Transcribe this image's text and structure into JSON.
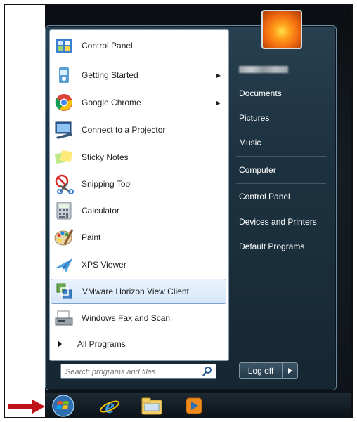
{
  "start_menu": {
    "programs": [
      {
        "label": "Control Panel",
        "icon": "control-panel-icon",
        "has_submenu": false
      },
      {
        "label": "Getting Started",
        "icon": "getting-started-icon",
        "has_submenu": true
      },
      {
        "label": "Google Chrome",
        "icon": "chrome-icon",
        "has_submenu": true
      },
      {
        "label": "Connect to a Projector",
        "icon": "projector-icon",
        "has_submenu": false
      },
      {
        "label": "Sticky Notes",
        "icon": "sticky-notes-icon",
        "has_submenu": false
      },
      {
        "label": "Snipping Tool",
        "icon": "snipping-tool-icon",
        "has_submenu": false
      },
      {
        "label": "Calculator",
        "icon": "calculator-icon",
        "has_submenu": false
      },
      {
        "label": "Paint",
        "icon": "paint-icon",
        "has_submenu": false
      },
      {
        "label": "XPS Viewer",
        "icon": "xps-viewer-icon",
        "has_submenu": false
      },
      {
        "label": "VMware Horizon View Client",
        "icon": "vmware-icon",
        "has_submenu": false,
        "selected": true
      },
      {
        "label": "Windows Fax and Scan",
        "icon": "fax-scan-icon",
        "has_submenu": false
      }
    ],
    "all_programs_label": "All Programs",
    "search_placeholder": "Search programs and files",
    "right_links": {
      "documents": "Documents",
      "pictures": "Pictures",
      "music": "Music",
      "computer": "Computer",
      "control_panel": "Control Panel",
      "devices_printers": "Devices and Printers",
      "default_programs": "Default Programs"
    },
    "logoff_label": "Log off"
  },
  "taskbar": {
    "icons": [
      "windows-start-orb-icon",
      "internet-explorer-icon",
      "file-explorer-icon",
      "media-player-icon"
    ]
  },
  "colors": {
    "selection_border": "#7da2ce",
    "menu_background": "#1d3241",
    "annotation_arrow": "#c0121a"
  }
}
